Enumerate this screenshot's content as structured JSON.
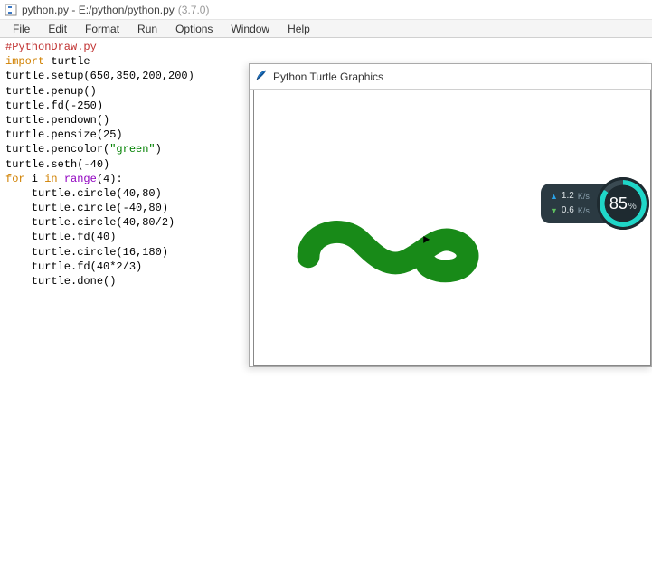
{
  "window": {
    "title": "python.py - E:/python/python.py",
    "version": "(3.7.0)"
  },
  "menu": {
    "items": [
      "File",
      "Edit",
      "Format",
      "Run",
      "Options",
      "Window",
      "Help"
    ]
  },
  "code": {
    "l0": "#PythonDraw.py",
    "l1a": "import",
    "l1b": " turtle",
    "l2": "turtle.setup(650,350,200,200)",
    "l3": "turtle.penup()",
    "l4": "turtle.fd(-250)",
    "l5": "turtle.pendown()",
    "l6": "turtle.pensize(25)",
    "l7a": "turtle.pencolor(",
    "l7b": "\"green\"",
    "l7c": ")",
    "l8": "turtle.seth(-40)",
    "l9a": "for",
    "l9b": " i ",
    "l9c": "in",
    "l9d": " ",
    "l9e": "range",
    "l9f": "(4):",
    "l10": "    turtle.circle(40,80)",
    "l11": "    turtle.circle(-40,80)",
    "l12": "    turtle.circle(40,80/2)",
    "l13": "    turtle.fd(40)",
    "l14": "    turtle.circle(16,180)",
    "l15": "    turtle.fd(40*2/3)",
    "l16": "    turtle.done()"
  },
  "turtle": {
    "title": "Python Turtle Graphics"
  },
  "overlay": {
    "up_value": "1.2",
    "up_unit": "K/s",
    "down_value": "0.6",
    "down_unit": "K/s",
    "gauge": "85",
    "gauge_unit": "%"
  }
}
